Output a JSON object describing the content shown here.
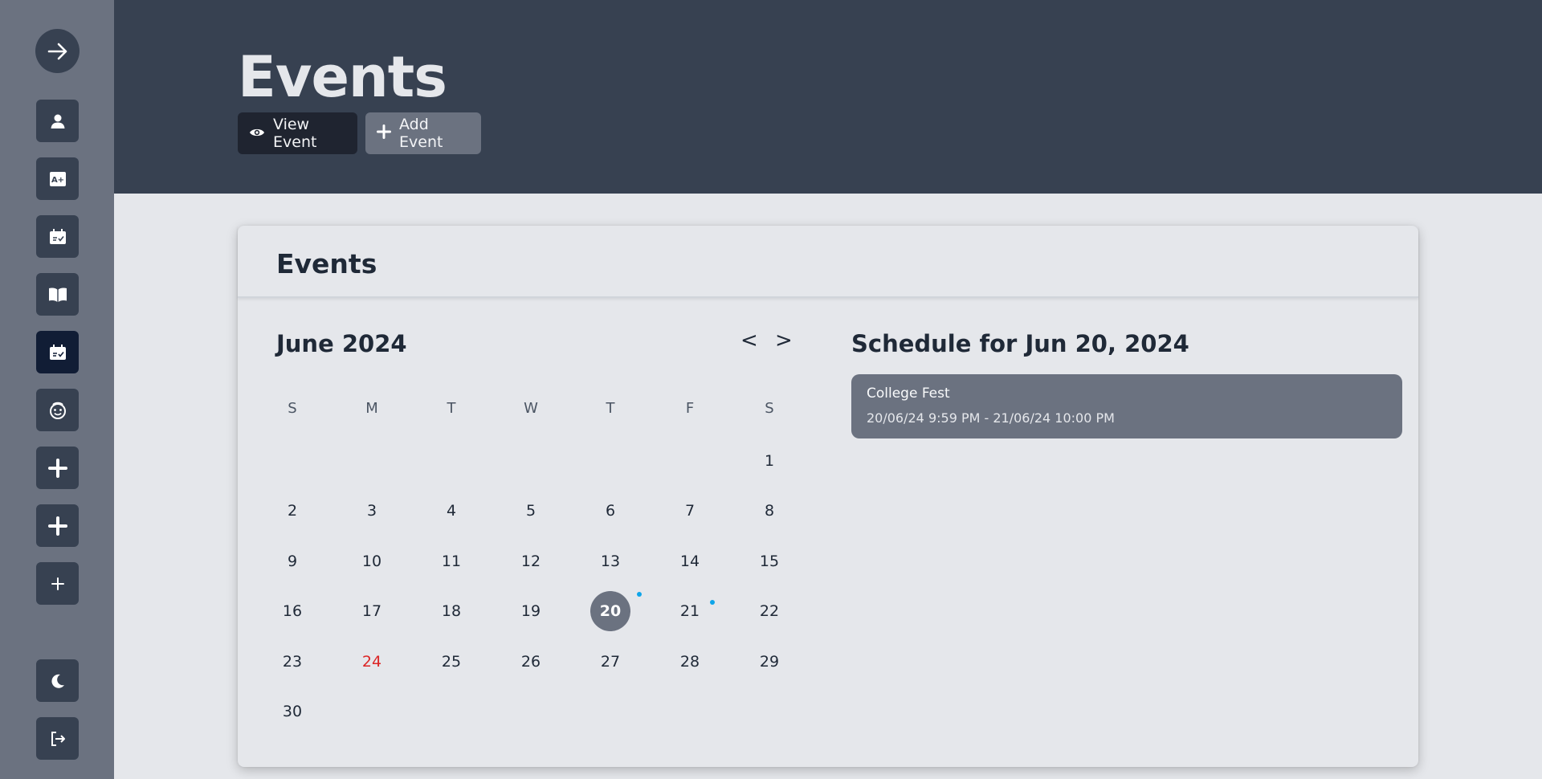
{
  "sidebar": {
    "items": [
      {
        "name": "profile-icon"
      },
      {
        "name": "grades-icon"
      },
      {
        "name": "calendar-check-icon"
      },
      {
        "name": "book-icon"
      },
      {
        "name": "events-icon",
        "active": true
      },
      {
        "name": "face-icon"
      },
      {
        "name": "plus-icon"
      },
      {
        "name": "plus-icon"
      },
      {
        "name": "plus-small-icon"
      },
      {
        "name": "dark-mode-icon"
      },
      {
        "name": "logout-icon"
      }
    ]
  },
  "header": {
    "title": "Events",
    "view_event_label": "View Event",
    "add_event_label": "Add Event"
  },
  "card": {
    "title": "Events"
  },
  "calendar": {
    "month_label": "June 2024",
    "prev_label": "<",
    "next_label": ">",
    "weekdays": [
      "S",
      "M",
      "T",
      "W",
      "T",
      "F",
      "S"
    ],
    "first_weekday_index": 6,
    "days_in_month": 30,
    "selected_day": 20,
    "today_day": 24,
    "event_dot_days": [
      20,
      21
    ]
  },
  "schedule": {
    "title": "Schedule for Jun 20, 2024",
    "events": [
      {
        "name": "College Fest",
        "time": "20/06/24 9:59 PM - 21/06/24 10:00 PM"
      }
    ]
  },
  "colors": {
    "sidebar_bg": "#6b7280",
    "header_bg": "#374151",
    "accent_dot": "#0ea5e9",
    "today_text": "#dc2626"
  }
}
